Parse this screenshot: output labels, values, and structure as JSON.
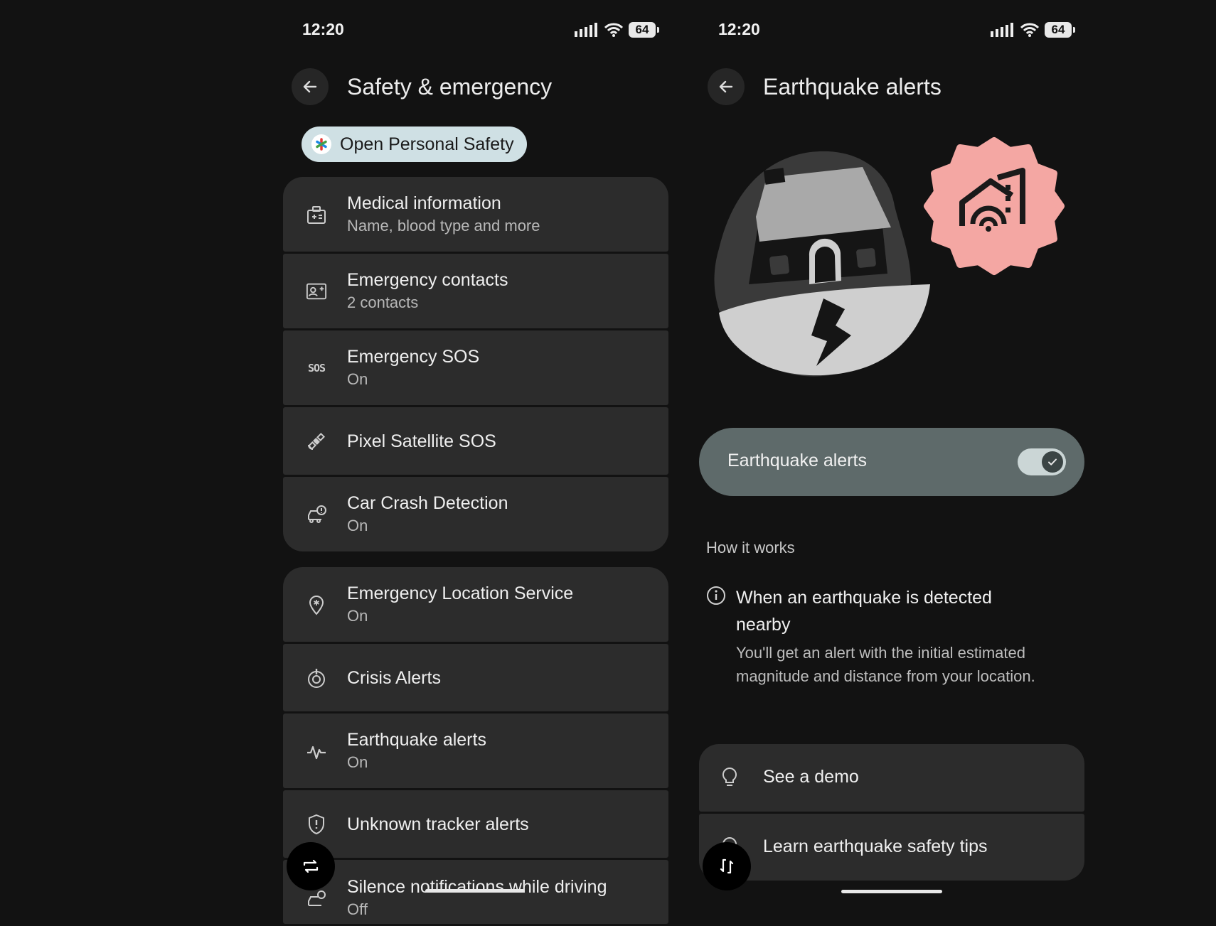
{
  "left": {
    "status": {
      "time": "12:20",
      "battery": "64"
    },
    "header": {
      "title": "Safety & emergency"
    },
    "chip": {
      "label": "Open Personal Safety"
    },
    "group1": [
      {
        "title": "Medical information",
        "subtitle": "Name, blood type and more",
        "icon": "medical-id-icon"
      },
      {
        "title": "Emergency contacts",
        "subtitle": "2 contacts",
        "icon": "contact-card-icon"
      },
      {
        "title": "Emergency SOS",
        "subtitle": "On",
        "icon": "sos-icon"
      },
      {
        "title": "Pixel Satellite SOS",
        "subtitle": "",
        "icon": "satellite-icon"
      },
      {
        "title": "Car Crash Detection",
        "subtitle": "On",
        "icon": "car-crash-icon"
      }
    ],
    "group2": [
      {
        "title": "Emergency Location Service",
        "subtitle": "On",
        "icon": "location-pin-icon"
      },
      {
        "title": "Crisis Alerts",
        "subtitle": "",
        "icon": "crisis-alert-icon"
      },
      {
        "title": "Earthquake alerts",
        "subtitle": "On",
        "icon": "seismic-wave-icon"
      },
      {
        "title": "Unknown tracker alerts",
        "subtitle": "",
        "icon": "shield-alert-icon"
      },
      {
        "title": "Silence notifications while driving",
        "subtitle": "Off",
        "icon": "car-bell-icon"
      }
    ],
    "sos_icon_text": "SOS"
  },
  "right": {
    "status": {
      "time": "12:20",
      "battery": "64"
    },
    "header": {
      "title": "Earthquake alerts"
    },
    "toggle": {
      "label": "Earthquake alerts",
      "checked": true
    },
    "how_it_works": {
      "header": "How it works",
      "title": "When an earthquake is detected nearby",
      "body": "You'll get an alert with the initial estimated magnitude and distance from your location."
    },
    "actions": [
      {
        "label": "See a demo",
        "icon": "lightbulb-icon"
      },
      {
        "label": "Learn earthquake safety tips",
        "icon": "lightbulb-icon"
      }
    ]
  },
  "colors": {
    "background": "#121212",
    "card": "#2c2c2c",
    "toggle_card": "#5e6a6a",
    "badge": "#f4a7a3",
    "chip": "#cfe0e4"
  }
}
